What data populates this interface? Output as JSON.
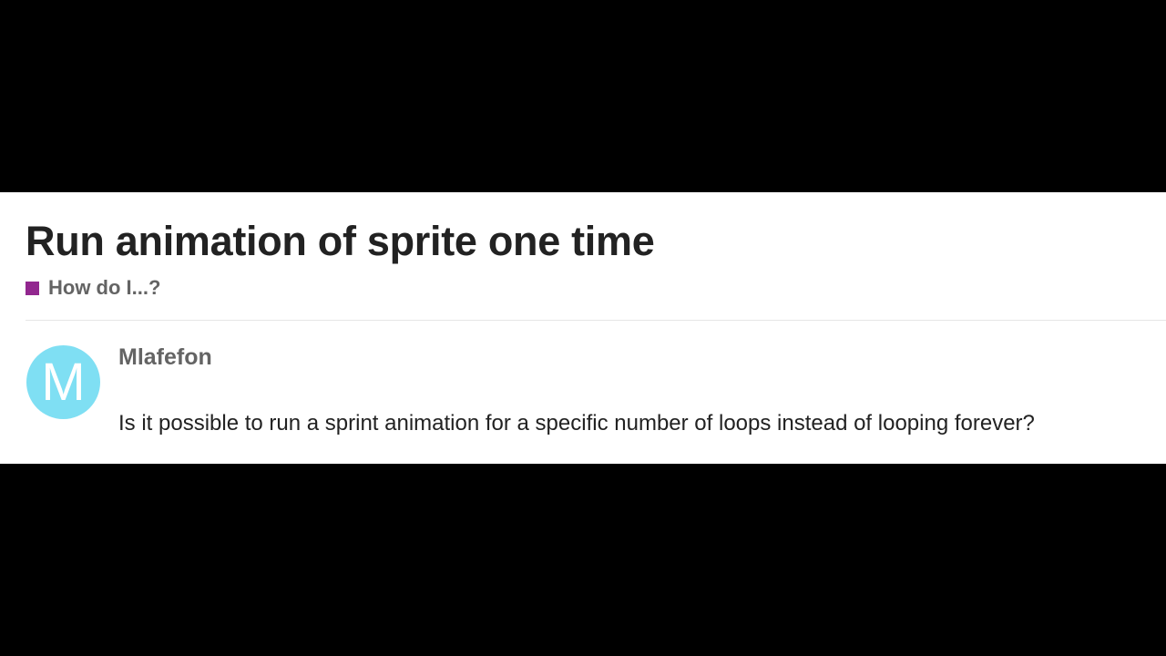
{
  "topic": {
    "title": "Run animation of sprite one time",
    "category": {
      "name": "How do I...?",
      "color": "#92278f"
    }
  },
  "post": {
    "author": {
      "username": "Mlafefon",
      "avatar_letter": "M",
      "avatar_color": "#7fdff3"
    },
    "body": "Is it possible to run a sprint animation for a specific number of loops instead of looping forever?"
  }
}
